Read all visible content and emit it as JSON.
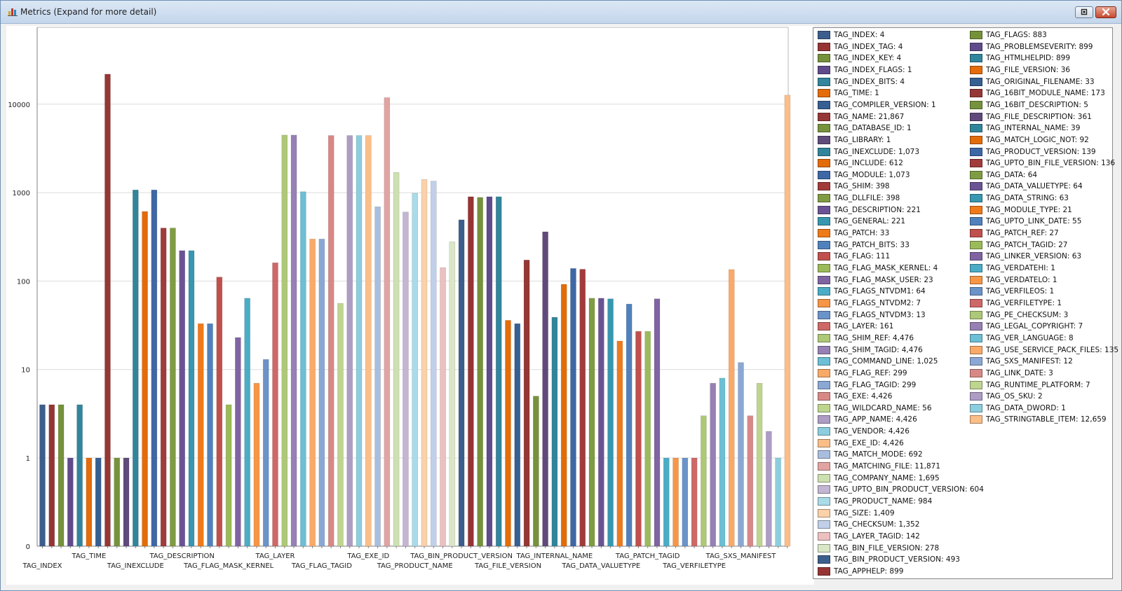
{
  "window": {
    "title": "Metrics (Expand for more detail)",
    "title_icon": "bar-chart-icon",
    "restore_icon": "restore-icon",
    "close_icon": "close-icon"
  },
  "chart_data": {
    "type": "bar",
    "scale": "log",
    "grid": true,
    "legend_placement": "right",
    "y_ticks": [
      "0",
      "1",
      "10",
      "100",
      "1000",
      "10000"
    ],
    "categories": [
      "TAG_INDEX",
      "TAG_INDEX_TAG",
      "TAG_INDEX_KEY",
      "TAG_INDEX_FLAGS",
      "TAG_INDEX_BITS",
      "TAG_TIME",
      "TAG_COMPILER_VERSION",
      "TAG_NAME",
      "TAG_DATABASE_ID",
      "TAG_LIBRARY",
      "TAG_INEXCLUDE",
      "TAG_INCLUDE",
      "TAG_MODULE",
      "TAG_SHIM",
      "TAG_DLLFILE",
      "TAG_DESCRIPTION",
      "TAG_GENERAL",
      "TAG_PATCH",
      "TAG_PATCH_BITS",
      "TAG_FLAG",
      "TAG_FLAG_MASK_KERNEL",
      "TAG_FLAG_MASK_USER",
      "TAG_FLAGS_NTVDM1",
      "TAG_FLAGS_NTVDM2",
      "TAG_FLAGS_NTVDM3",
      "TAG_LAYER",
      "TAG_SHIM_REF",
      "TAG_SHIM_TAGID",
      "TAG_COMMAND_LINE",
      "TAG_FLAG_REF",
      "TAG_FLAG_TAGID",
      "TAG_EXE",
      "TAG_WILDCARD_NAME",
      "TAG_APP_NAME",
      "TAG_VENDOR",
      "TAG_EXE_ID",
      "TAG_MATCH_MODE",
      "TAG_MATCHING_FILE",
      "TAG_COMPANY_NAME",
      "TAG_UPTO_BIN_PRODUCT_VERSION",
      "TAG_PRODUCT_NAME",
      "TAG_SIZE",
      "TAG_CHECKSUM",
      "TAG_LAYER_TAGID",
      "TAG_BIN_FILE_VERSION",
      "TAG_BIN_PRODUCT_VERSION",
      "TAG_APPHELP",
      "TAG_FLAGS",
      "TAG_PROBLEMSEVERITY",
      "TAG_HTMLHELPID",
      "TAG_FILE_VERSION",
      "TAG_ORIGINAL_FILENAME",
      "TAG_16BIT_MODULE_NAME",
      "TAG_16BIT_DESCRIPTION",
      "TAG_FILE_DESCRIPTION",
      "TAG_INTERNAL_NAME",
      "TAG_MATCH_LOGIC_NOT",
      "TAG_PRODUCT_VERSION",
      "TAG_UPTO_BIN_FILE_VERSION",
      "TAG_DATA",
      "TAG_DATA_VALUETYPE",
      "TAG_DATA_STRING",
      "TAG_MODULE_TYPE",
      "TAG_UPTO_LINK_DATE",
      "TAG_PATCH_REF",
      "TAG_PATCH_TAGID",
      "TAG_LINKER_VERSION",
      "TAG_VERDATEHI",
      "TAG_VERDATELO",
      "TAG_VERFILEOS",
      "TAG_VERFILETYPE",
      "TAG_PE_CHECKSUM",
      "TAG_LEGAL_COPYRIGHT",
      "TAG_VER_LANGUAGE",
      "TAG_USE_SERVICE_PACK_FILES",
      "TAG_SXS_MANIFEST",
      "TAG_LINK_DATE",
      "TAG_RUNTIME_PLATFORM",
      "TAG_OS_SKU",
      "TAG_DATA_DWORD",
      "TAG_STRINGTABLE_ITEM"
    ],
    "values": [
      4,
      4,
      4,
      1,
      4,
      1,
      1,
      21867,
      1,
      1,
      1073,
      612,
      1073,
      398,
      398,
      221,
      221,
      33,
      33,
      111,
      4,
      23,
      64,
      7,
      13,
      161,
      4476,
      4476,
      1025,
      299,
      299,
      4426,
      56,
      4426,
      4426,
      4426,
      692,
      11871,
      1695,
      604,
      984,
      1409,
      1352,
      142,
      278,
      493,
      899,
      883,
      899,
      899,
      36,
      33,
      173,
      5,
      361,
      39,
      92,
      139,
      136,
      64,
      64,
      63,
      21,
      55,
      27,
      27,
      63,
      1,
      1,
      1,
      1,
      3,
      7,
      8,
      135,
      12,
      3,
      7,
      2,
      1,
      12659
    ],
    "value_labels": [
      "4",
      "4",
      "4",
      "1",
      "4",
      "1",
      "1",
      "21,867",
      "1",
      "1",
      "1,073",
      "612",
      "1,073",
      "398",
      "398",
      "221",
      "221",
      "33",
      "33",
      "111",
      "4",
      "23",
      "64",
      "7",
      "13",
      "161",
      "4,476",
      "4,476",
      "1,025",
      "299",
      "299",
      "4,426",
      "56",
      "4,426",
      "4,426",
      "4,426",
      "692",
      "11,871",
      "1,695",
      "604",
      "984",
      "1,409",
      "1,352",
      "142",
      "278",
      "493",
      "899",
      "883",
      "899",
      "899",
      "36",
      "33",
      "173",
      "5",
      "361",
      "39",
      "92",
      "139",
      "136",
      "64",
      "64",
      "63",
      "21",
      "55",
      "27",
      "27",
      "63",
      "1",
      "1",
      "1",
      "1",
      "3",
      "7",
      "8",
      "135",
      "12",
      "3",
      "7",
      "2",
      "1",
      "12,659"
    ],
    "x_axis_labels": [
      {
        "index": 0,
        "label": "TAG_INDEX",
        "row": 2
      },
      {
        "index": 5,
        "label": "TAG_TIME",
        "row": 1
      },
      {
        "index": 10,
        "label": "TAG_INEXCLUDE",
        "row": 2
      },
      {
        "index": 15,
        "label": "TAG_DESCRIPTION",
        "row": 1
      },
      {
        "index": 20,
        "label": "TAG_FLAG_MASK_KERNEL",
        "row": 2
      },
      {
        "index": 25,
        "label": "TAG_LAYER",
        "row": 1
      },
      {
        "index": 30,
        "label": "TAG_FLAG_TAGID",
        "row": 2
      },
      {
        "index": 35,
        "label": "TAG_EXE_ID",
        "row": 1
      },
      {
        "index": 40,
        "label": "TAG_PRODUCT_NAME",
        "row": 2
      },
      {
        "index": 45,
        "label": "TAG_BIN_PRODUCT_VERSION",
        "row": 1
      },
      {
        "index": 50,
        "label": "TAG_FILE_VERSION",
        "row": 2
      },
      {
        "index": 55,
        "label": "TAG_INTERNAL_NAME",
        "row": 1
      },
      {
        "index": 60,
        "label": "TAG_DATA_VALUETYPE",
        "row": 2
      },
      {
        "index": 65,
        "label": "TAG_PATCH_TAGID",
        "row": 1
      },
      {
        "index": 70,
        "label": "TAG_VERFILETYPE",
        "row": 2
      },
      {
        "index": 75,
        "label": "TAG_SXS_MANIFEST",
        "row": 1
      }
    ],
    "colors": [
      "#3c5e8c",
      "#963434",
      "#75923a",
      "#5f4b8b",
      "#31859c",
      "#e46c0a",
      "#365f92",
      "#953735",
      "#76923c",
      "#604a7b",
      "#31859b",
      "#e36c09",
      "#3e67a6",
      "#a23b3b",
      "#7f9c42",
      "#6a5394",
      "#3797b0",
      "#ef7a1a",
      "#4f81bd",
      "#c0504d",
      "#9bbb59",
      "#8064a2",
      "#4bacc6",
      "#f79646",
      "#6a93c9",
      "#cd6866",
      "#adc876",
      "#9780b4",
      "#6cbfd4",
      "#f9aa67",
      "#8ba8d4",
      "#d78886",
      "#bed58f",
      "#ad9cc4",
      "#8ccedf",
      "#fbbe88",
      "#a9bedf",
      "#e1a4a2",
      "#cde0b0",
      "#c2b6d3",
      "#a9dbe8",
      "#fbd1aa",
      "#c1d0e8",
      "#ebc0bf",
      "#d9e7c6"
    ]
  }
}
